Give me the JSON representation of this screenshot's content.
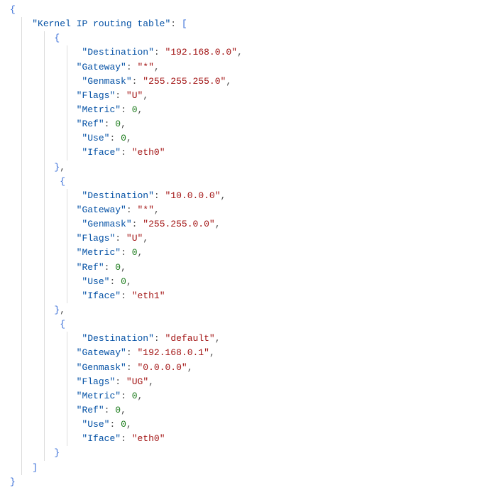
{
  "top_key": "Kernel IP routing table",
  "field_keys": {
    "Destination": "Destination",
    "Gateway": "Gateway",
    "Genmask": "Genmask",
    "Flags": "Flags",
    "Metric": "Metric",
    "Ref": "Ref",
    "Use": "Use",
    "Iface": "Iface"
  },
  "routes": [
    {
      "Destination": "192.168.0.0",
      "Gateway": "*",
      "Genmask": "255.255.255.0",
      "Flags": "U",
      "Metric": 0,
      "Ref": 0,
      "Use": 0,
      "Iface": "eth0"
    },
    {
      "Destination": "10.0.0.0",
      "Gateway": "*",
      "Genmask": "255.255.0.0",
      "Flags": "U",
      "Metric": 0,
      "Ref": 0,
      "Use": 0,
      "Iface": "eth1"
    },
    {
      "Destination": "default",
      "Gateway": "192.168.0.1",
      "Genmask": "0.0.0.0",
      "Flags": "UG",
      "Metric": 0,
      "Ref": 0,
      "Use": 0,
      "Iface": "eth0"
    }
  ]
}
